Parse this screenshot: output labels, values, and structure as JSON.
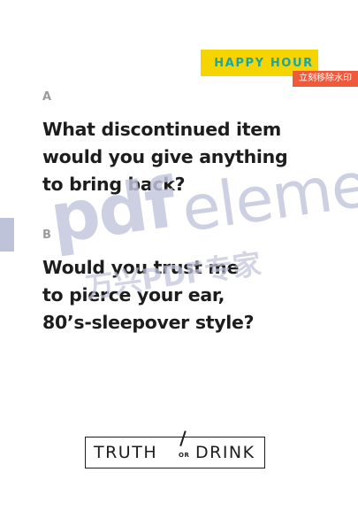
{
  "tag": {
    "label": "HAPPY HOUR"
  },
  "watermark_button": {
    "label": "立刻移除水印"
  },
  "question_a": {
    "letter": "A",
    "lines": [
      "What discontinued item",
      "would you give anything",
      "to bring back?"
    ]
  },
  "question_b": {
    "letter": "B",
    "lines": [
      "Would you trust me",
      "to pierce your ear,",
      "80’s-sleepover style?"
    ]
  },
  "watermark": {
    "brand": "pdf",
    "brand_rest": "eleme",
    "cn": "万兴PDF专家"
  },
  "logo": {
    "word1": "TRUTH",
    "connector": "OR",
    "word2": "DRINK"
  },
  "colors": {
    "tag_bg": "#f6d400",
    "tag_text": "#18a7a7",
    "button_bg": "#f05a3c",
    "text": "#1d1d1d",
    "watermark": "#c3c6dd"
  }
}
